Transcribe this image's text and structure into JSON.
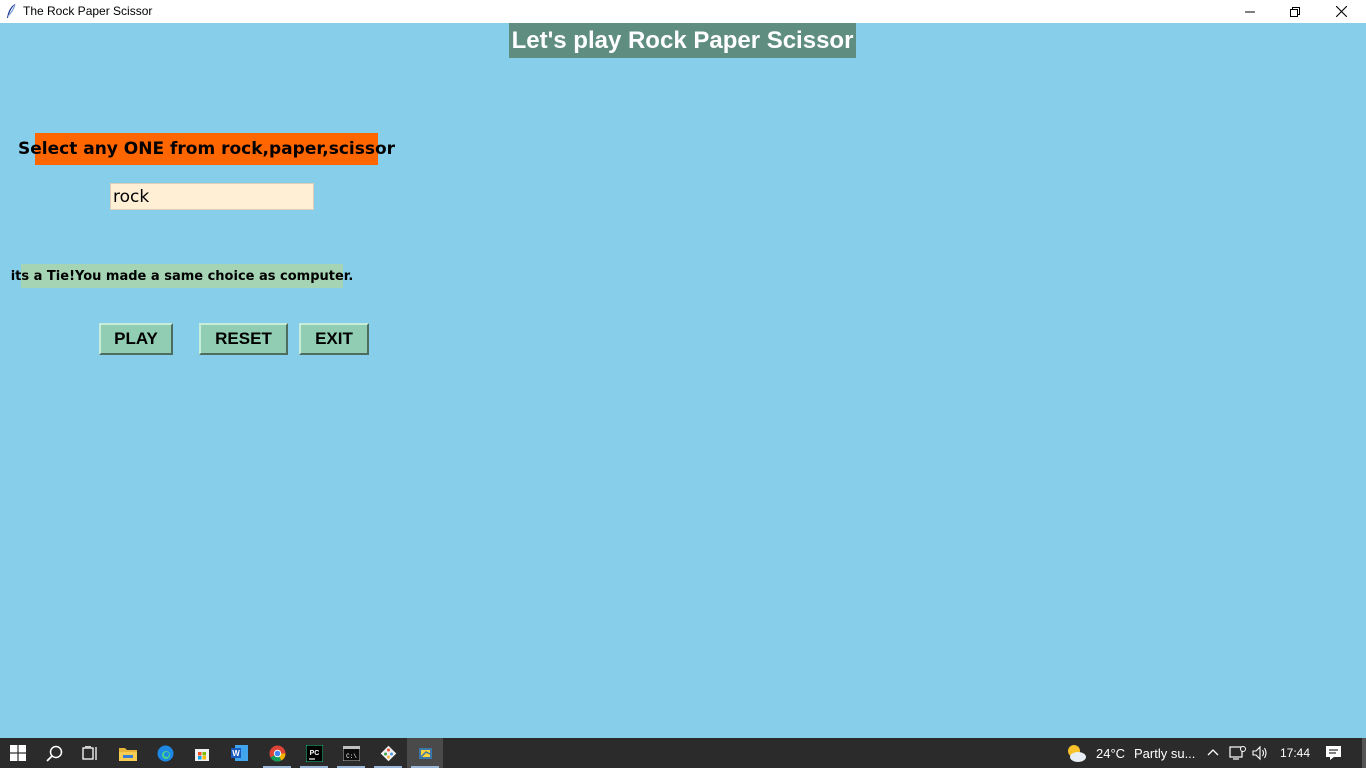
{
  "window": {
    "title": "The Rock Paper Scissor"
  },
  "app": {
    "heading": "Let's play Rock Paper Scissor",
    "prompt": "Select any ONE from rock,paper,scissor",
    "choice_value": "rock",
    "result": "its a Tie!You made a same choice as computer.",
    "buttons": {
      "play": "PLAY",
      "reset": "RESET",
      "exit": "EXIT"
    }
  },
  "colors": {
    "background": "#87ceeb",
    "heading_bg": "#5f8e80",
    "prompt_bg": "#ff6600",
    "input_bg": "#ffefd5",
    "result_bg": "#a4d4b4",
    "button_bg": "#90cdb2"
  },
  "taskbar": {
    "items": [
      {
        "name": "start-button",
        "icon": "windows-logo-icon"
      },
      {
        "name": "search-button",
        "icon": "search-icon"
      },
      {
        "name": "task-view-button",
        "icon": "task-view-icon"
      },
      {
        "name": "file-explorer",
        "icon": "folder-icon"
      },
      {
        "name": "edge",
        "icon": "edge-icon"
      },
      {
        "name": "store",
        "icon": "store-icon"
      },
      {
        "name": "word",
        "icon": "word-icon"
      },
      {
        "name": "chrome",
        "icon": "chrome-icon"
      },
      {
        "name": "pycharm",
        "icon": "pycharm-icon"
      },
      {
        "name": "terminal",
        "icon": "terminal-icon"
      },
      {
        "name": "git",
        "icon": "git-icon"
      },
      {
        "name": "python",
        "icon": "python-icon"
      }
    ],
    "weather": {
      "temperature": "24°C",
      "condition": "Partly su..."
    },
    "time": "17:44"
  }
}
